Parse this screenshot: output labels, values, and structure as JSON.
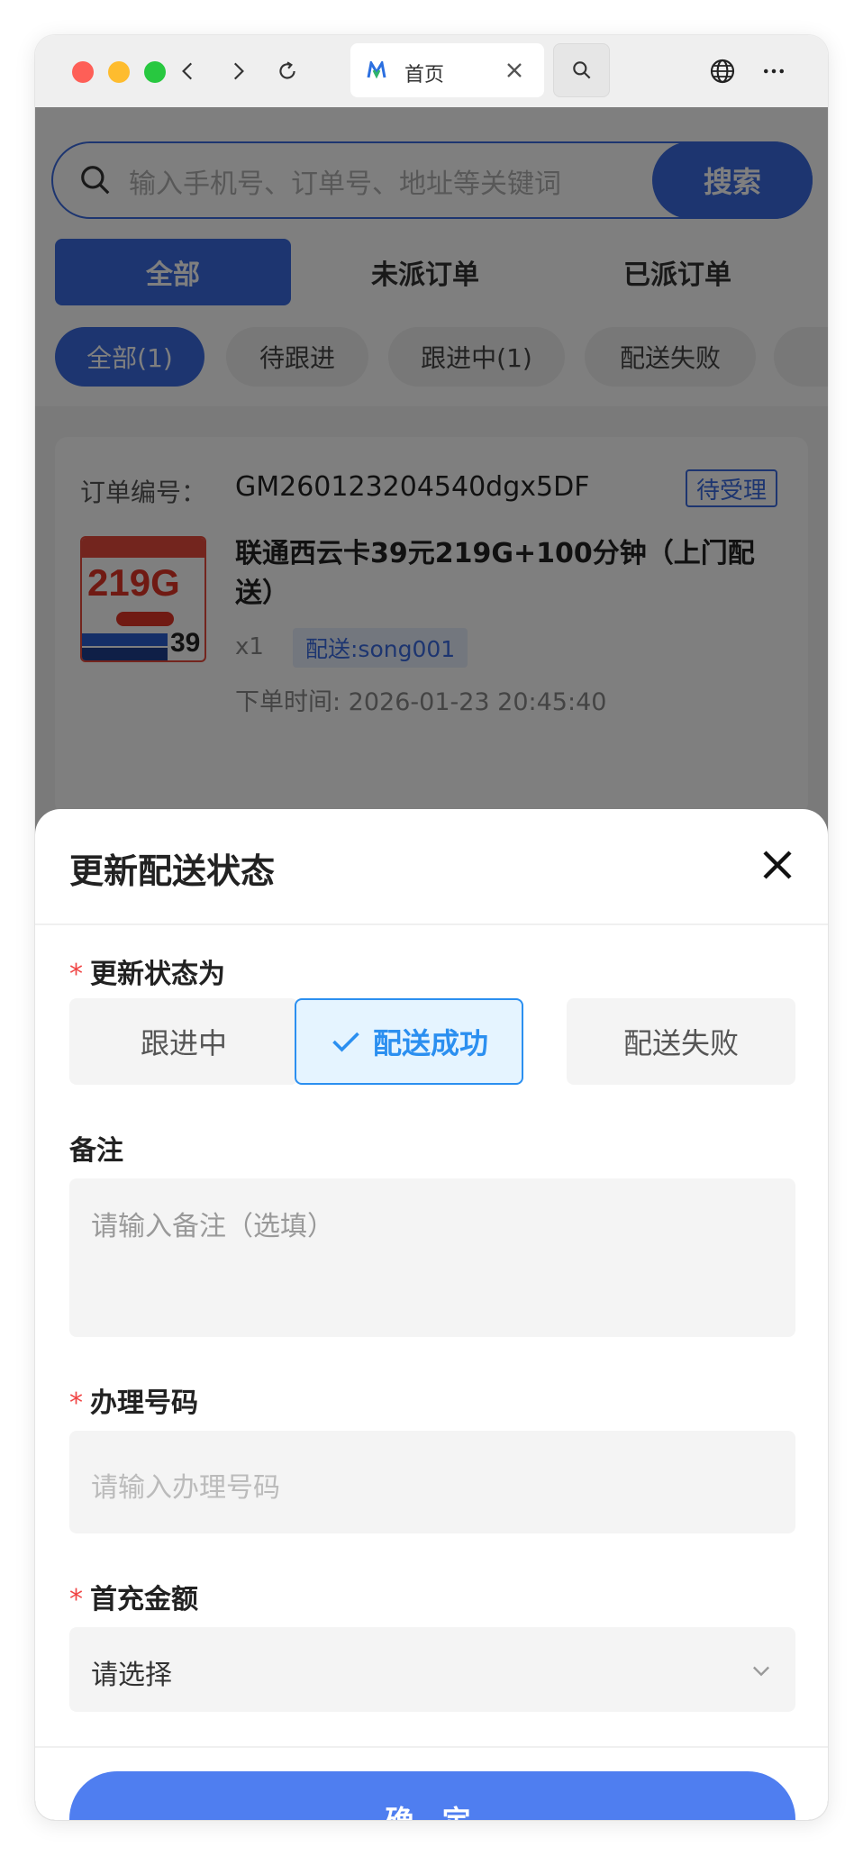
{
  "browser": {
    "tab_title": "首页"
  },
  "page": {
    "search": {
      "placeholder": "输入手机号、订单号、地址等关键词",
      "button": "搜索"
    },
    "main_tabs": [
      "全部",
      "未派订单",
      "已派订单"
    ],
    "status_pills": [
      "全部(1)",
      "待跟进",
      "跟进中(1)",
      "配送失败"
    ],
    "order": {
      "number_label": "订单编号：",
      "number": "GM260123204540dgx5DF",
      "badge": "待受理",
      "thumb_big": "219G",
      "thumb_num": "39",
      "title": "联通西云卡39元219G+100分钟（上门配送）",
      "qty": "x1",
      "delivery_tag": "配送:song001",
      "order_time": "下单时间: 2026-01-23 20:45:40"
    }
  },
  "sheet": {
    "title": "更新配送状态",
    "status_label": "更新状态为",
    "status_options": [
      "跟进中",
      "配送成功",
      "配送失败"
    ],
    "selected_status": "配送成功",
    "remark_label": "备注",
    "remark_placeholder": "请输入备注（选填）",
    "phone_label": "办理号码",
    "phone_placeholder": "请输入办理号码",
    "amount_label": "首充金额",
    "amount_value": "请选择",
    "required_mark": "*",
    "confirm": "确 定"
  },
  "colors": {
    "primary": "#3a6be0",
    "confirm": "#4f7ef0",
    "selected_border": "#2b8ff0",
    "required": "#f04545"
  }
}
